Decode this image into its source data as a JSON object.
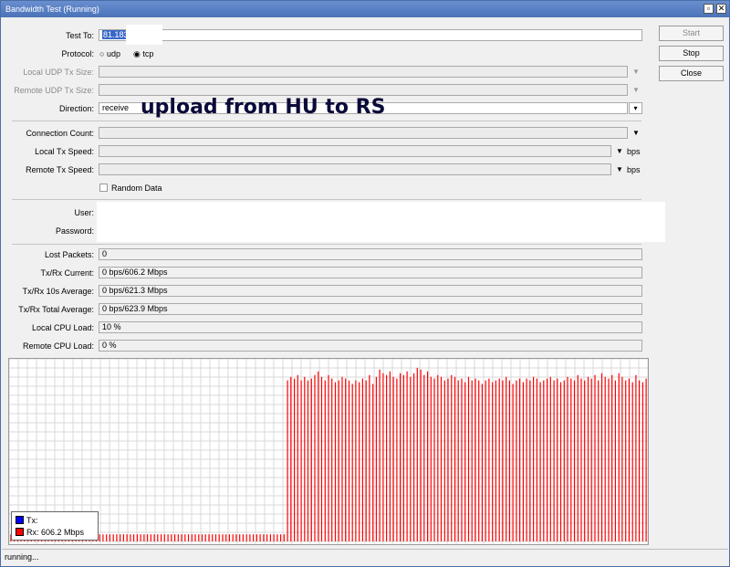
{
  "window": {
    "title": "Bandwidth Test (Running)",
    "minimize_glyph": "▫",
    "close_glyph": "✕"
  },
  "buttons": {
    "start": "Start",
    "stop": "Stop",
    "close": "Close"
  },
  "form": {
    "test_to_label": "Test To:",
    "test_to_value": "81.183",
    "protocol_label": "Protocol:",
    "udp_label": "udp",
    "tcp_label": "tcp",
    "local_udp_label": "Local UDP Tx Size:",
    "remote_udp_label": "Remote UDP Tx Size:",
    "direction_label": "Direction:",
    "direction_value": "receive",
    "connection_count_label": "Connection Count:",
    "local_tx_label": "Local Tx Speed:",
    "remote_tx_label": "Remote Tx Speed:",
    "bps_unit": "bps",
    "random_data_label": "Random Data",
    "user_label": "User:",
    "password_label": "Password:"
  },
  "stats": {
    "lost_packets_label": "Lost Packets:",
    "lost_packets": "0",
    "current_label": "Tx/Rx Current:",
    "current": "0 bps/606.2 Mbps",
    "avg10_label": "Tx/Rx 10s Average:",
    "avg10": "0 bps/621.3 Mbps",
    "total_avg_label": "Tx/Rx Total Average:",
    "total_avg": "0 bps/623.9 Mbps",
    "local_cpu_label": "Local CPU Load:",
    "local_cpu": "10 %",
    "remote_cpu_label": "Remote CPU Load:",
    "remote_cpu": "0 %"
  },
  "annotation": "upload from HU to RS",
  "chart_data": {
    "type": "bar",
    "legend_placement": "bottom-left",
    "grid": true,
    "series": [
      {
        "name": "Tx:",
        "color": "#0000ff",
        "values": []
      },
      {
        "name": "Rx:  606.2 Mbps",
        "color": "#ff0000",
        "values": [
          0.04,
          0.04,
          0.04,
          0.04,
          0.04,
          0.04,
          0.04,
          0.04,
          0.04,
          0.04,
          0.04,
          0.04,
          0.04,
          0.04,
          0.04,
          0.04,
          0.04,
          0.04,
          0.04,
          0.04,
          0.04,
          0.04,
          0.04,
          0.04,
          0.04,
          0.04,
          0.04,
          0.04,
          0.04,
          0.04,
          0.04,
          0.04,
          0.04,
          0.04,
          0.04,
          0.04,
          0.04,
          0.04,
          0.04,
          0.04,
          0.04,
          0.04,
          0.04,
          0.04,
          0.04,
          0.04,
          0.04,
          0.04,
          0.04,
          0.04,
          0.04,
          0.04,
          0.04,
          0.04,
          0.04,
          0.04,
          0.04,
          0.04,
          0.04,
          0.04,
          0.04,
          0.04,
          0.04,
          0.04,
          0.04,
          0.04,
          0.04,
          0.04,
          0.04,
          0.04,
          0.04,
          0.04,
          0.04,
          0.04,
          0.04,
          0.04,
          0.04,
          0.04,
          0.04,
          0.04,
          0.04,
          0.9,
          0.92,
          0.91,
          0.93,
          0.9,
          0.92,
          0.9,
          0.91,
          0.93,
          0.95,
          0.92,
          0.9,
          0.93,
          0.91,
          0.89,
          0.9,
          0.92,
          0.91,
          0.9,
          0.88,
          0.9,
          0.89,
          0.91,
          0.9,
          0.93,
          0.88,
          0.92,
          0.96,
          0.94,
          0.93,
          0.95,
          0.92,
          0.91,
          0.94,
          0.93,
          0.95,
          0.92,
          0.94,
          0.97,
          0.96,
          0.93,
          0.95,
          0.92,
          0.91,
          0.93,
          0.92,
          0.9,
          0.91,
          0.93,
          0.92,
          0.9,
          0.91,
          0.89,
          0.92,
          0.9,
          0.91,
          0.9,
          0.88,
          0.9,
          0.91,
          0.89,
          0.9,
          0.91,
          0.9,
          0.92,
          0.9,
          0.88,
          0.9,
          0.91,
          0.89,
          0.91,
          0.9,
          0.92,
          0.91,
          0.89,
          0.9,
          0.91,
          0.92,
          0.9,
          0.91,
          0.89,
          0.9,
          0.92,
          0.91,
          0.9,
          0.93,
          0.91,
          0.9,
          0.92,
          0.91,
          0.93,
          0.9,
          0.94,
          0.92,
          0.91,
          0.93,
          0.9,
          0.94,
          0.92,
          0.9,
          0.91,
          0.89,
          0.93,
          0.9,
          0.89,
          0.91
        ]
      }
    ]
  },
  "status_text": "running..."
}
